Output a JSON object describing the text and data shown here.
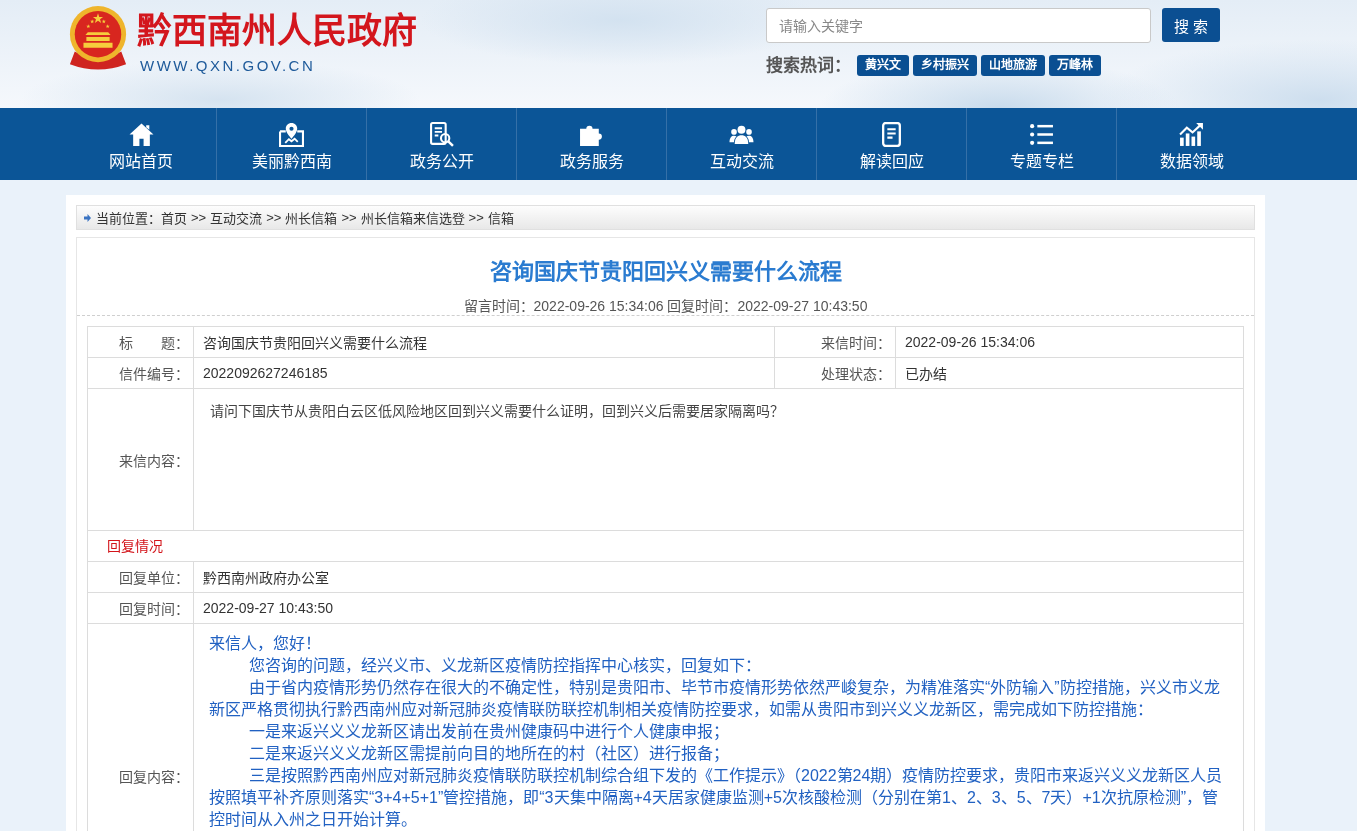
{
  "header": {
    "site_name": "黔西南州人民政府",
    "site_url": "WWW.QXN.GOV.CN",
    "search": {
      "placeholder": "请输入关键字",
      "button": "搜 索"
    },
    "hot_words": {
      "label": "搜索热词：",
      "tags": [
        "黄兴文",
        "乡村振兴",
        "山地旅游",
        "万峰林"
      ]
    }
  },
  "nav": {
    "items": [
      "网站首页",
      "美丽黔西南",
      "政务公开",
      "政务服务",
      "互动交流",
      "解读回应",
      "专题专栏",
      "数据领域"
    ]
  },
  "breadcrumb": {
    "label": "当前位置：",
    "separator": ">>",
    "items": [
      "首页",
      "互动交流",
      "州长信箱",
      "州长信箱来信选登",
      "信箱"
    ]
  },
  "letter": {
    "title": "咨询国庆节贵阳回兴义需要什么流程",
    "meta": "留言时间：2022-09-26 15:34:06 回复时间：2022-09-27 10:43:50",
    "details": [
      {
        "kind": "fields",
        "fields": [
          {
            "label": "标　　题：",
            "value": "咨询国庆节贵阳回兴义需要什么流程"
          },
          {
            "label": "来信时间：",
            "value": "2022-09-26 15:34:06"
          }
        ]
      },
      {
        "kind": "fields",
        "fields": [
          {
            "label": "信件编号：",
            "value": "2022092627246185"
          },
          {
            "label": "处理状态：",
            "value": "已办结"
          }
        ]
      },
      {
        "kind": "letter",
        "label": "来信内容：",
        "paragraphs": [
          "请问下国庆节从贵阳白云区低风险地区回到兴义需要什么证明，回到兴义后需要居家隔离吗？"
        ]
      },
      {
        "kind": "section",
        "title": "回复情况"
      },
      {
        "kind": "fields",
        "fields": [
          {
            "label": "回复单位：",
            "value": "黔西南州政府办公室"
          }
        ]
      },
      {
        "kind": "fields",
        "fields": [
          {
            "label": "回复时间：",
            "value": "2022-09-27 10:43:50"
          }
        ]
      },
      {
        "kind": "reply",
        "label": "回复内容：",
        "greeting": "来信人，您好！",
        "paragraphs": [
          "您咨询的问题，经兴义市、义龙新区疫情防控指挥中心核实，回复如下：",
          "由于省内疫情形势仍然存在很大的不确定性，特别是贵阳市、毕节市疫情形势依然严峻复杂，为精准落实“外防输入”防控措施，兴义市义龙新区严格贯彻执行黔西南州应对新冠肺炎疫情联防联控机制相关疫情防控要求，如需从贵阳市到兴义义龙新区，需完成如下防控措施：",
          "一是来返兴义义龙新区请出发前在贵州健康码中进行个人健康申报；",
          "二是来返兴义义龙新区需提前向目的地所在的村（社区）进行报备；",
          "三是按照黔西南州应对新冠肺炎疫情联防联控机制综合组下发的《工作提示》（2022第24期）疫情防控要求，贵阳市来返兴义义龙新区人员按照填平补齐原则落实“3+4+5+1”管控措施，即“3天集中隔离+4天居家健康监测+5次核酸检测（分别在第1、2、3、5、7天）+1次抗原检测”，管控时间从入州之日开始计算。"
        ]
      }
    ]
  }
}
